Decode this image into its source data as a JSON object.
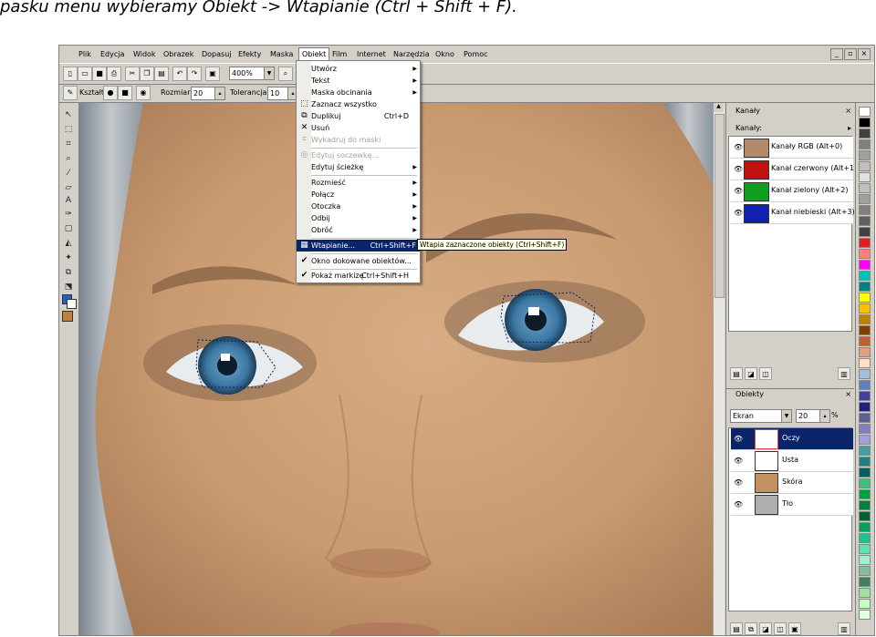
{
  "caption": "pasku menu wybieramy Obiekt -> Wtapianie (Ctrl + Shift + F).",
  "menubar": [
    "Plik",
    "Edycja",
    "Widok",
    "Obrazek",
    "Dopasuj",
    "Efekty",
    "Maska",
    "Obiekt",
    "Film",
    "Internet",
    "Narzędzia",
    "Okno",
    "Pomoc"
  ],
  "window_buttons": [
    "_",
    "▫",
    "×"
  ],
  "toolbar": {
    "zoom": "400%",
    "shape_label": "Kształt",
    "size_label": "Rozmiar",
    "size_value": "20",
    "tolerance_label": "Tolerancja",
    "tolerance_value": "10"
  },
  "menu": {
    "items": [
      {
        "label": "Utwórz",
        "submenu": true
      },
      {
        "label": "Tekst",
        "submenu": true
      },
      {
        "label": "Maska obcinania",
        "submenu": true
      },
      {
        "label": "Zaznacz wszystko"
      },
      {
        "label": "Duplikuj",
        "shortcut": "Ctrl+D"
      },
      {
        "label": "Usuń"
      },
      {
        "label": "Wykadruj do maski",
        "disabled": true
      },
      {
        "label": "Edytuj soczewkę...",
        "disabled": true
      },
      {
        "label": "Edytuj ścieżkę",
        "submenu": true
      },
      {
        "label": "Rozmieść",
        "submenu": true
      },
      {
        "label": "Połącz",
        "submenu": true
      },
      {
        "label": "Otoczka",
        "submenu": true
      },
      {
        "label": "Odbij",
        "submenu": true
      },
      {
        "label": "Obróć",
        "submenu": true
      },
      {
        "label": "Wtapianie...",
        "shortcut": "Ctrl+Shift+F",
        "highlighted": true
      },
      {
        "label": "Okno dokowane obiektów..."
      },
      {
        "label": "Pokaż markizę",
        "shortcut": "Ctrl+Shift+H"
      }
    ],
    "tooltip": "Wtapia zaznaczone obiekty (Ctrl+Shift+F)"
  },
  "channels": {
    "title": "Kanały",
    "header": "Kanały:",
    "rows": [
      {
        "name": "Kanały RGB (Alt+0)",
        "color": "#b58a6a"
      },
      {
        "name": "Kanał czerwony (Alt+1)",
        "color": "#c01010"
      },
      {
        "name": "Kanał zielony (Alt+2)",
        "color": "#10a020"
      },
      {
        "name": "Kanał niebieski (Alt+3)",
        "color": "#1020b0"
      }
    ]
  },
  "objects": {
    "title": "Obiekty",
    "mode": "Ekran",
    "opacity": "20",
    "percent": "%",
    "rows": [
      {
        "name": "Oczy",
        "selected": true
      },
      {
        "name": "Usta"
      },
      {
        "name": "Skóra"
      },
      {
        "name": "Tło"
      }
    ]
  },
  "palette": [
    "#ffffff",
    "#000000",
    "#404040",
    "#808080",
    "#a0a0a0",
    "#c0c0c0",
    "#e0e0e0",
    "#c0c0c0",
    "#a0a0a0",
    "#808080",
    "#606060",
    "#404040",
    "#e02020",
    "#ff8080",
    "#ff00ff",
    "#00c0c0",
    "#008080",
    "#ffff00",
    "#ffc000",
    "#c08000",
    "#804000",
    "#c06030",
    "#e0a080",
    "#ffe0c0",
    "#a0c0e0",
    "#6080c0",
    "#4040a0",
    "#202080",
    "#606090",
    "#8080c0",
    "#a0a0e0",
    "#40a0a0",
    "#208080",
    "#006060",
    "#40c080",
    "#00a040",
    "#008040",
    "#006030",
    "#00a060",
    "#20c090",
    "#60e0b0",
    "#a0f0d0",
    "#80c0a0",
    "#408060",
    "#a0e0a0",
    "#c0ffc0",
    "#e0ffe0"
  ]
}
